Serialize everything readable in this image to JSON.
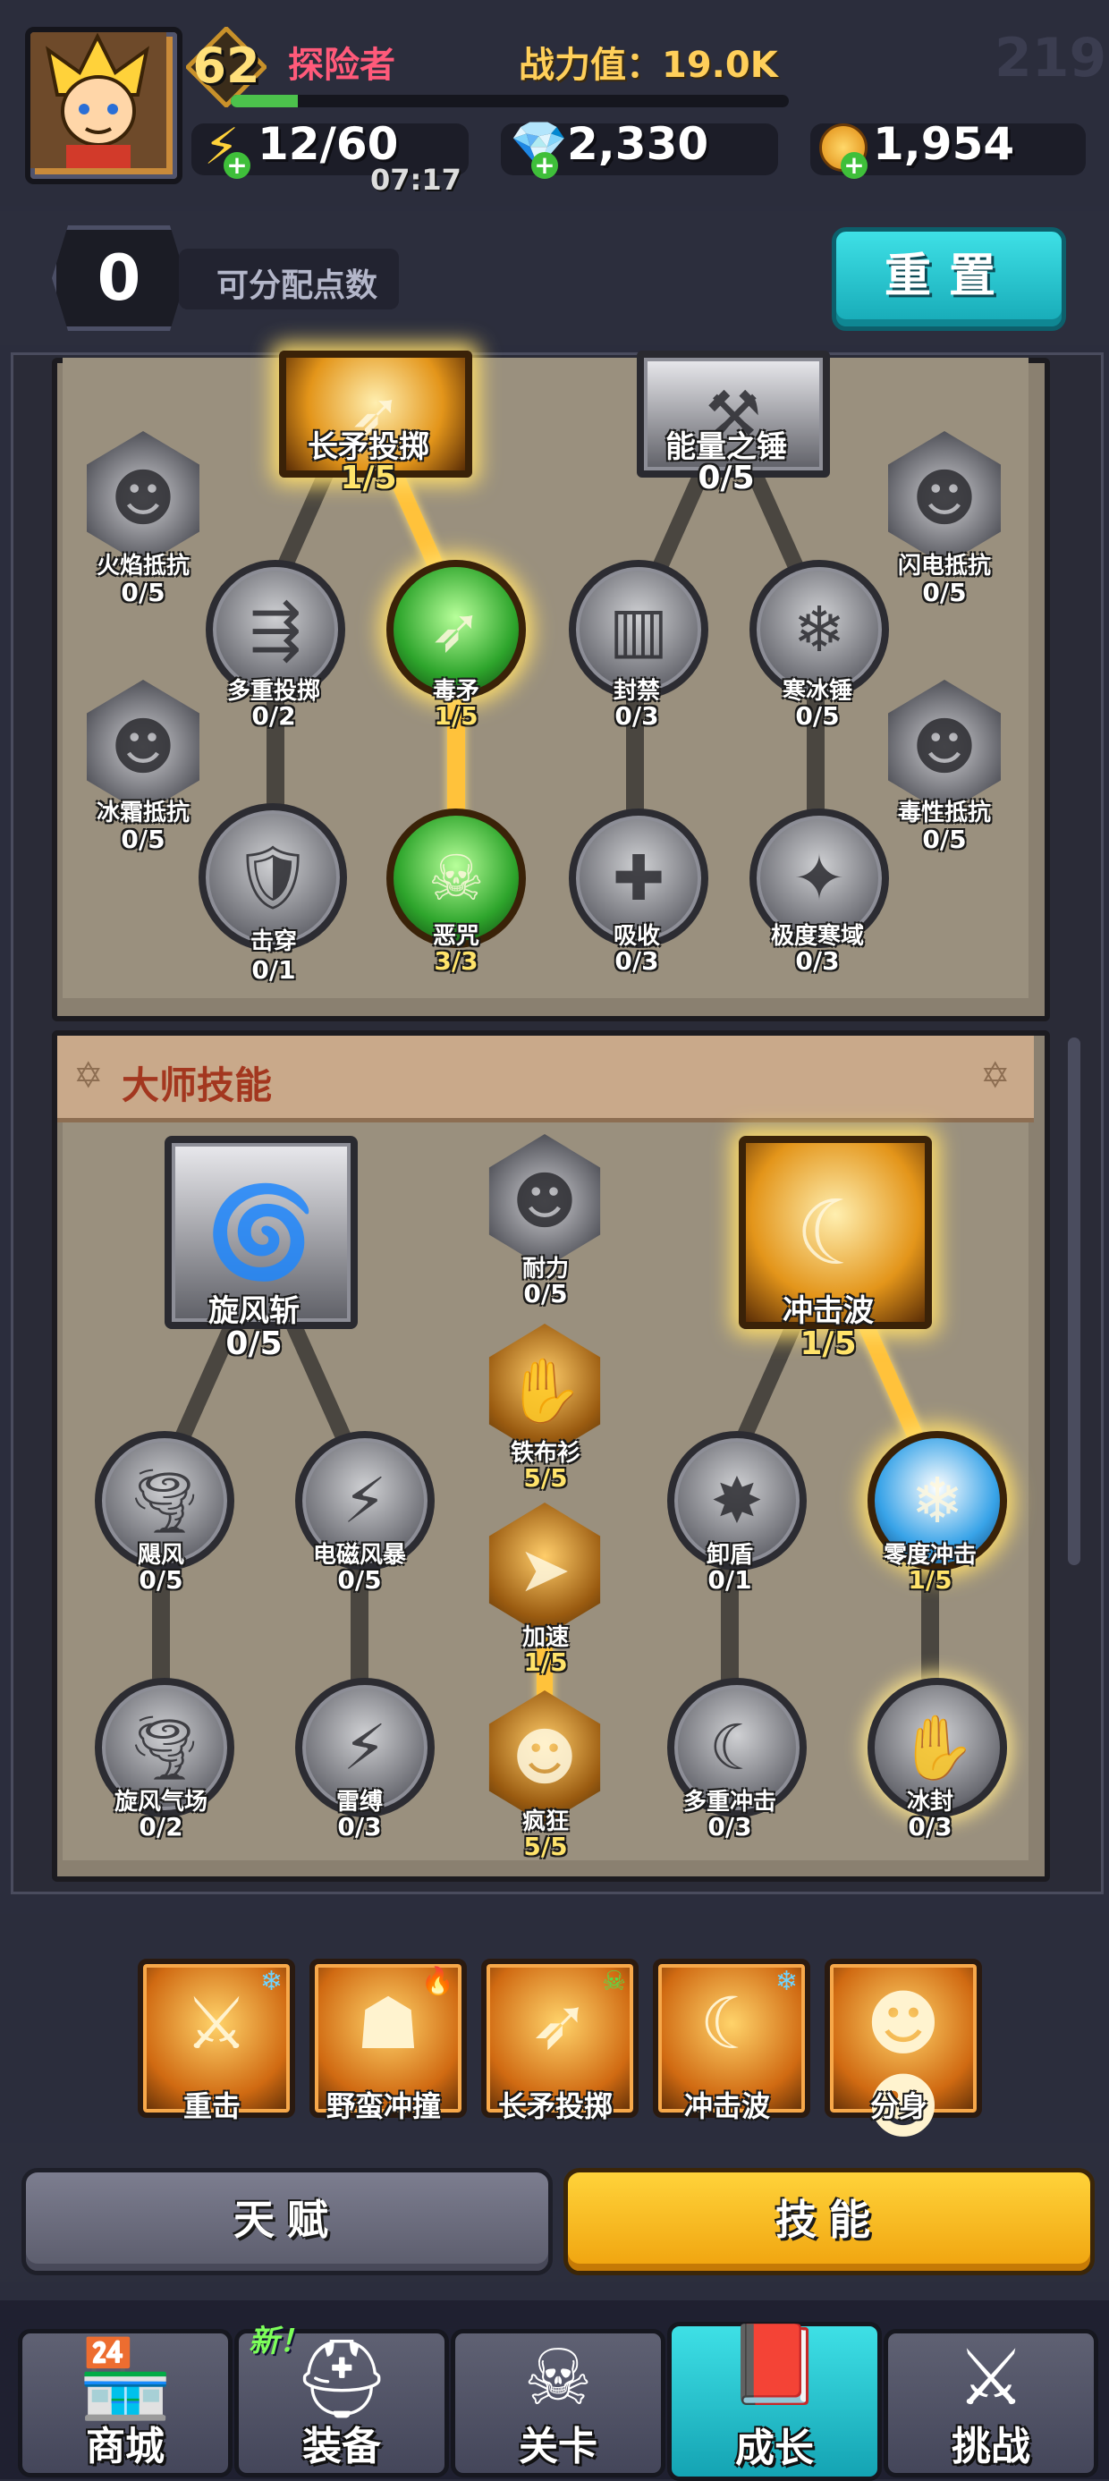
{
  "header": {
    "level": "62",
    "rank_title": "探险者",
    "power_label": "战力值：19.0K",
    "xp_fraction": 0.12,
    "energy": "12/60",
    "energy_timer": "07:17",
    "gems": "2,330",
    "coins": "1,954",
    "ghost_number": "219"
  },
  "points": {
    "value": "0",
    "label": "可分配点数",
    "reset_label": "重置"
  },
  "tree_upper": {
    "nodes": [
      {
        "name": "长矛投掷",
        "count": "1/5"
      },
      {
        "name": "能量之锤",
        "count": "0/5"
      },
      {
        "name": "火焰抵抗",
        "count": "0/5"
      },
      {
        "name": "闪电抵抗",
        "count": "0/5"
      },
      {
        "name": "多重投掷",
        "count": "0/2"
      },
      {
        "name": "毒矛",
        "count": "1/5"
      },
      {
        "name": "封禁",
        "count": "0/3"
      },
      {
        "name": "寒冰锤",
        "count": "0/5"
      },
      {
        "name": "冰霜抵抗",
        "count": "0/5"
      },
      {
        "name": "毒性抵抗",
        "count": "0/5"
      },
      {
        "name": "击穿",
        "count": "0/1"
      },
      {
        "name": "恶咒",
        "count": "3/3"
      },
      {
        "name": "吸收",
        "count": "0/3"
      },
      {
        "name": "极度寒域",
        "count": "0/3"
      }
    ]
  },
  "master": {
    "title": "大师技能",
    "nodes": [
      {
        "name": "旋风斩",
        "count": "0/5"
      },
      {
        "name": "耐力",
        "count": "0/5"
      },
      {
        "name": "冲击波",
        "count": "1/5"
      },
      {
        "name": "铁布衫",
        "count": "5/5"
      },
      {
        "name": "飓风",
        "count": "0/5"
      },
      {
        "name": "电磁风暴",
        "count": "0/5"
      },
      {
        "name": "卸盾",
        "count": "0/1"
      },
      {
        "name": "零度冲击",
        "count": "1/5"
      },
      {
        "name": "加速",
        "count": "1/5"
      },
      {
        "name": "旋风气场",
        "count": "0/2"
      },
      {
        "name": "雷缚",
        "count": "0/3"
      },
      {
        "name": "疯狂",
        "count": "5/5"
      },
      {
        "name": "多重冲击",
        "count": "0/3"
      },
      {
        "name": "冰封",
        "count": "0/3"
      }
    ]
  },
  "equipped": [
    {
      "label": "重击",
      "badge": "snowflake-icon"
    },
    {
      "label": "野蛮冲撞",
      "badge": "fire-icon"
    },
    {
      "label": "长矛投掷",
      "badge": "skull-icon"
    },
    {
      "label": "冲击波",
      "badge": "snowflake-icon"
    },
    {
      "label": "分身",
      "badge": ""
    }
  ],
  "tabs": {
    "talent": "天赋",
    "skill": "技能",
    "active": "技能"
  },
  "nav": {
    "new_badge": "新！",
    "items": [
      "商城",
      "装备",
      "关卡",
      "成长",
      "挑战"
    ],
    "active": "成长"
  },
  "colors": {
    "accent_teal": "#2bc4cf",
    "accent_gold": "#ffc23b",
    "rank_pink": "#ff5a7a"
  }
}
